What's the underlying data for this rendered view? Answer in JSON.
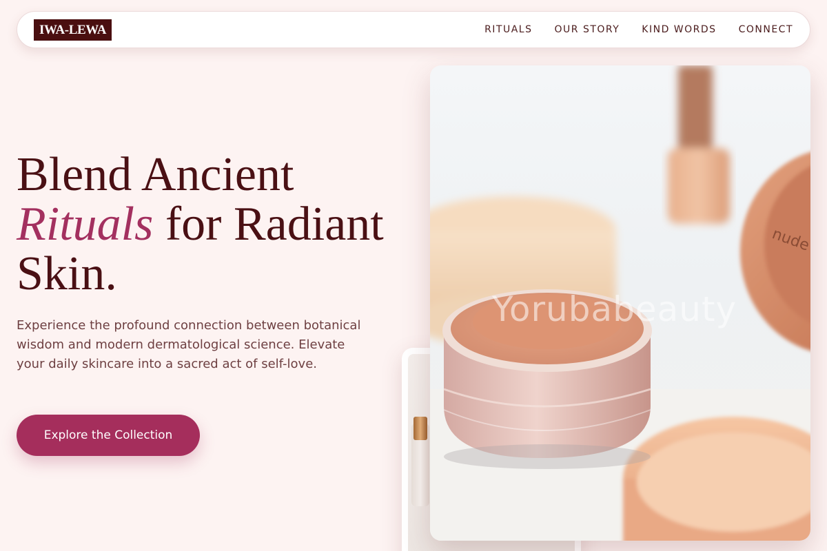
{
  "brand": {
    "logo": "IWA-LEWA"
  },
  "nav": {
    "items": [
      {
        "label": "RITUALS"
      },
      {
        "label": "OUR STORY"
      },
      {
        "label": "KIND WORDS"
      },
      {
        "label": "CONNECT"
      }
    ]
  },
  "hero": {
    "title_line1": "Blend Ancient",
    "title_accent": "Rituals",
    "title_line2_rest": " for Radiant",
    "title_line3": "Skin.",
    "description": "Experience the profound connection between botanical wisdom and modern dermatological science. Elevate your daily skincare into a sacred act of self-love.",
    "cta_label": "Explore the Collection"
  },
  "image": {
    "watermark": "Yorubabeauty",
    "jar_lid_text": "nude"
  },
  "colors": {
    "background": "#fdf3f2",
    "brand_dark": "#4a0f10",
    "accent": "#a3305f",
    "button": "#a52e5c",
    "body_text": "#6d3f41"
  }
}
